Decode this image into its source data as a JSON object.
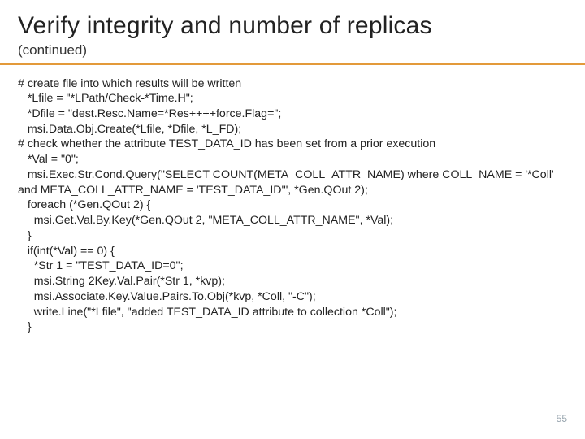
{
  "title": "Verify integrity and number of replicas",
  "subtitle": "(continued)",
  "page_number": "55",
  "code_lines": [
    "# create file into which results will be written",
    "   *Lfile = \"*LPath/Check-*Time.H\";",
    "   *Dfile = \"dest.Resc.Name=*Res++++force.Flag=\";",
    "   msi.Data.Obj.Create(*Lfile, *Dfile, *L_FD);",
    "# check whether the attribute TEST_DATA_ID has been set from a prior execution",
    "   *Val = \"0\";",
    "   msi.Exec.Str.Cond.Query(\"SELECT COUNT(META_COLL_ATTR_NAME) where COLL_NAME = '*Coll' and META_COLL_ATTR_NAME = 'TEST_DATA_ID'\", *Gen.QOut 2);",
    "   foreach (*Gen.QOut 2) {",
    "     msi.Get.Val.By.Key(*Gen.QOut 2, \"META_COLL_ATTR_NAME\", *Val);",
    "   }",
    "   if(int(*Val) == 0) {",
    "     *Str 1 = \"TEST_DATA_ID=0\";",
    "     msi.String 2Key.Val.Pair(*Str 1, *kvp);",
    "     msi.Associate.Key.Value.Pairs.To.Obj(*kvp, *Coll, \"-C\");",
    "     write.Line(\"*Lfile\", \"added TEST_DATA_ID attribute to collection *Coll\");",
    "   }"
  ]
}
